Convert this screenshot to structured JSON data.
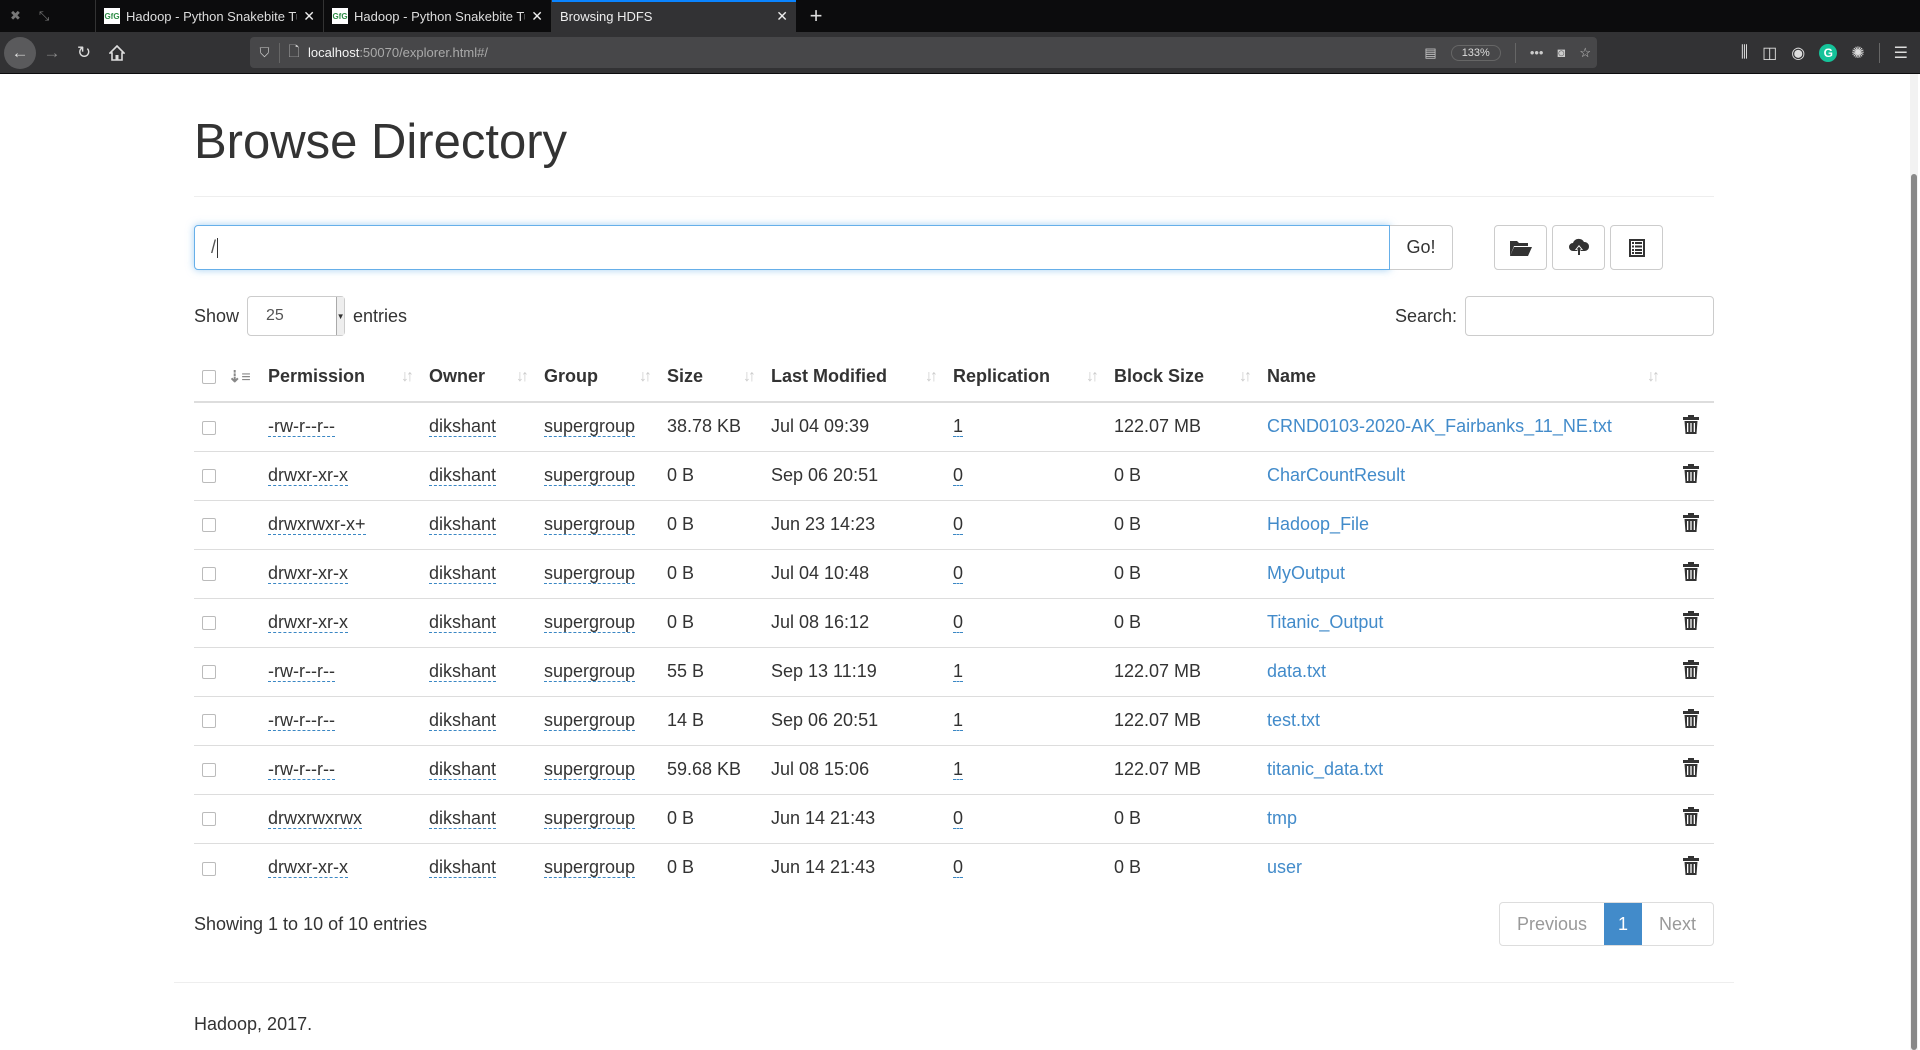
{
  "browser": {
    "tabs": [
      {
        "label": "Hadoop - Python Snakebite Tu",
        "favicon": "GfG",
        "active": false
      },
      {
        "label": "Hadoop - Python Snakebite Tu",
        "favicon": "GfG",
        "active": false
      },
      {
        "label": "Browsing HDFS",
        "active": true
      }
    ],
    "url_host": "localhost",
    "url_rest": ":50070/explorer.html#/",
    "zoom_level": "133%"
  },
  "page": {
    "title": "Browse Directory",
    "path_value": "/",
    "go_label": "Go!",
    "toolbar_icons": [
      "folder-open-icon",
      "cloud-upload-icon",
      "list-alt-icon"
    ],
    "show_label": "Show",
    "entries_label": "entries",
    "page_length": "25",
    "search_label": "Search:",
    "search_value": "",
    "columns": [
      "Permission",
      "Owner",
      "Group",
      "Size",
      "Last Modified",
      "Replication",
      "Block Size",
      "Name"
    ],
    "rows": [
      {
        "permission": "-rw-r--r--",
        "owner": "dikshant",
        "group": "supergroup",
        "size": "38.78 KB",
        "modified": "Jul 04 09:39",
        "replication": "1",
        "block_size": "122.07 MB",
        "name": "CRND0103-2020-AK_Fairbanks_11_NE.txt"
      },
      {
        "permission": "drwxr-xr-x",
        "owner": "dikshant",
        "group": "supergroup",
        "size": "0 B",
        "modified": "Sep 06 20:51",
        "replication": "0",
        "block_size": "0 B",
        "name": "CharCountResult"
      },
      {
        "permission": "drwxrwxr-x+",
        "owner": "dikshant",
        "group": "supergroup",
        "size": "0 B",
        "modified": "Jun 23 14:23",
        "replication": "0",
        "block_size": "0 B",
        "name": "Hadoop_File"
      },
      {
        "permission": "drwxr-xr-x",
        "owner": "dikshant",
        "group": "supergroup",
        "size": "0 B",
        "modified": "Jul 04 10:48",
        "replication": "0",
        "block_size": "0 B",
        "name": "MyOutput"
      },
      {
        "permission": "drwxr-xr-x",
        "owner": "dikshant",
        "group": "supergroup",
        "size": "0 B",
        "modified": "Jul 08 16:12",
        "replication": "0",
        "block_size": "0 B",
        "name": "Titanic_Output"
      },
      {
        "permission": "-rw-r--r--",
        "owner": "dikshant",
        "group": "supergroup",
        "size": "55 B",
        "modified": "Sep 13 11:19",
        "replication": "1",
        "block_size": "122.07 MB",
        "name": "data.txt"
      },
      {
        "permission": "-rw-r--r--",
        "owner": "dikshant",
        "group": "supergroup",
        "size": "14 B",
        "modified": "Sep 06 20:51",
        "replication": "1",
        "block_size": "122.07 MB",
        "name": "test.txt"
      },
      {
        "permission": "-rw-r--r--",
        "owner": "dikshant",
        "group": "supergroup",
        "size": "59.68 KB",
        "modified": "Jul 08 15:06",
        "replication": "1",
        "block_size": "122.07 MB",
        "name": "titanic_data.txt"
      },
      {
        "permission": "drwxrwxrwx",
        "owner": "dikshant",
        "group": "supergroup",
        "size": "0 B",
        "modified": "Jun 14 21:43",
        "replication": "0",
        "block_size": "0 B",
        "name": "tmp"
      },
      {
        "permission": "drwxr-xr-x",
        "owner": "dikshant",
        "group": "supergroup",
        "size": "0 B",
        "modified": "Jun 14 21:43",
        "replication": "0",
        "block_size": "0 B",
        "name": "user"
      }
    ],
    "info_text": "Showing 1 to 10 of 10 entries",
    "pagination": {
      "previous": "Previous",
      "current": "1",
      "next": "Next"
    },
    "footer": "Hadoop, 2017.",
    "colors": {
      "link": "#428bca",
      "focus": "#66afe9",
      "active_page": "#428bca"
    }
  }
}
